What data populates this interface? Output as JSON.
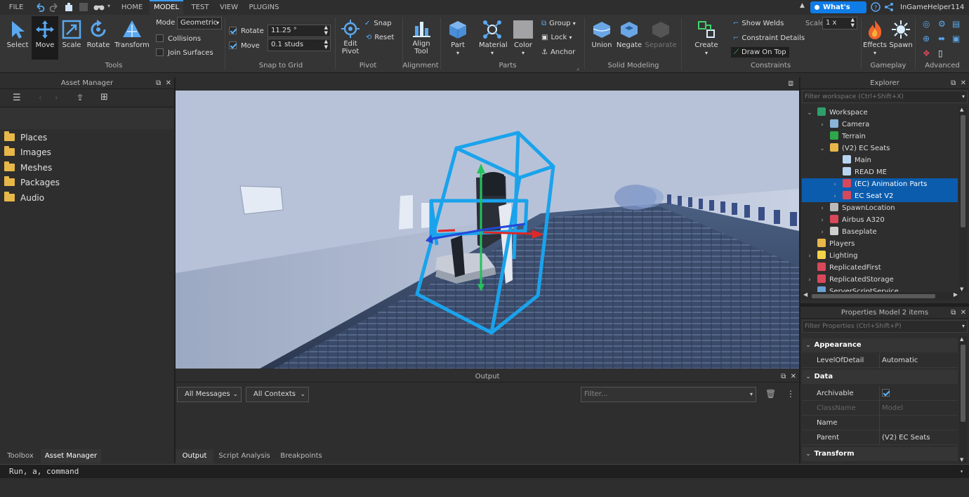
{
  "menubar": {
    "file": "FILE",
    "tabs": [
      "HOME",
      "MODEL",
      "TEST",
      "VIEW",
      "PLUGINS"
    ],
    "active_tab": "MODEL",
    "whats_new": "What's New",
    "username": "InGameHelper114"
  },
  "ribbon": {
    "tools": {
      "select": "Select",
      "move": "Move",
      "scale": "Scale",
      "rotate": "Rotate",
      "transform": "Transform",
      "group": "Tools"
    },
    "mode": {
      "label": "Mode",
      "value": "Geometric",
      "collisions": "Collisions",
      "join_surfaces": "Join Surfaces"
    },
    "snap": {
      "rotate": "Rotate",
      "rotate_value": "11.25 °",
      "move": "Move",
      "move_value": "0.1 studs",
      "group": "Snap to Grid"
    },
    "pivot": {
      "edit": "Edit",
      "edit2": "Pivot",
      "snap": "Snap",
      "reset": "Reset",
      "group": "Pivot"
    },
    "alignment": {
      "align": "Align",
      "align2": "Tool",
      "group": "Alignment"
    },
    "parts": {
      "part": "Part",
      "material": "Material",
      "color": "Color",
      "group_btn": "Group",
      "lock": "Lock",
      "anchor": "Anchor",
      "group": "Parts"
    },
    "solid": {
      "union": "Union",
      "negate": "Negate",
      "separate": "Separate",
      "group": "Solid Modeling"
    },
    "constraints": {
      "create": "Create",
      "show_welds": "Show Welds",
      "constraint_details": "Constraint Details",
      "draw_on_top": "Draw On Top",
      "scale_label": "Scale",
      "scale_value": "1 x",
      "group": "Constraints"
    },
    "gameplay": {
      "effects": "Effects",
      "spawn": "Spawn",
      "group": "Gameplay"
    },
    "advanced": {
      "group": "Advanced"
    }
  },
  "asset_manager": {
    "title": "Asset Manager",
    "items": [
      "Places",
      "Images",
      "Meshes",
      "Packages",
      "Audio"
    ],
    "bottom_tabs": [
      "Toolbox",
      "Asset Manager"
    ]
  },
  "output": {
    "title": "Output",
    "messages_filter": "All Messages",
    "contexts_filter": "All Contexts",
    "filter_placeholder": "Filter...",
    "tabs": [
      "Output",
      "Script Analysis",
      "Breakpoints"
    ]
  },
  "explorer": {
    "title": "Explorer",
    "filter_placeholder": "Filter workspace (Ctrl+Shift+X)",
    "tree": [
      {
        "label": "Workspace",
        "arrow": "⌄",
        "icon": "#2e9e6a",
        "selected": false
      },
      {
        "label": "Camera",
        "arrow": "›",
        "icon": "#8ab4d8",
        "selected": false
      },
      {
        "label": "Terrain",
        "arrow": "",
        "icon": "#2ea84a",
        "selected": false
      },
      {
        "label": "(V2) EC Seats",
        "arrow": "⌄",
        "icon": "#e8b74a",
        "selected": false
      },
      {
        "label": "Main",
        "arrow": "",
        "icon": "#b9d4f0",
        "selected": false
      },
      {
        "label": "READ ME",
        "arrow": "",
        "icon": "#b9d4f0",
        "selected": false
      },
      {
        "label": "(EC) Animation Parts",
        "arrow": "›",
        "icon": "#d8485a",
        "selected": true
      },
      {
        "label": "EC Seat V2",
        "arrow": "›",
        "icon": "#d8485a",
        "selected": true
      },
      {
        "label": "SpawnLocation",
        "arrow": "›",
        "icon": "#bbbbbb",
        "selected": false
      },
      {
        "label": "Airbus A320",
        "arrow": "›",
        "icon": "#d8485a",
        "selected": false
      },
      {
        "label": "Baseplate",
        "arrow": "›",
        "icon": "#cfcfcf",
        "selected": false
      },
      {
        "label": "Players",
        "arrow": "",
        "icon": "#e8b74a",
        "selected": false
      },
      {
        "label": "Lighting",
        "arrow": "›",
        "icon": "#f2d34a",
        "selected": false
      },
      {
        "label": "ReplicatedFirst",
        "arrow": "",
        "icon": "#d8485a",
        "selected": false
      },
      {
        "label": "ReplicatedStorage",
        "arrow": "›",
        "icon": "#d8485a",
        "selected": false
      },
      {
        "label": "ServerScriptService",
        "arrow": "",
        "icon": "#6aa0d8",
        "selected": false
      }
    ]
  },
  "properties": {
    "title": "Properties  Model  2 items",
    "filter_placeholder": "Filter Properties (Ctrl+Shift+P)",
    "sections": {
      "appearance": "Appearance",
      "data": "Data",
      "transform": "Transform"
    },
    "level_of_detail": {
      "key": "LevelOfDetail",
      "value": "Automatic"
    },
    "archivable": {
      "key": "Archivable"
    },
    "classname": {
      "key": "ClassName",
      "value": "Model"
    },
    "name": {
      "key": "Name",
      "value": ""
    },
    "parent": {
      "key": "Parent",
      "value": "(V2) EC Seats"
    }
  },
  "command_bar": {
    "text": "Run, a, command"
  },
  "colors": {
    "accent": "#0b5cad",
    "whats_new": "#0f7ce8",
    "selection_box": "#1aa3ec"
  }
}
